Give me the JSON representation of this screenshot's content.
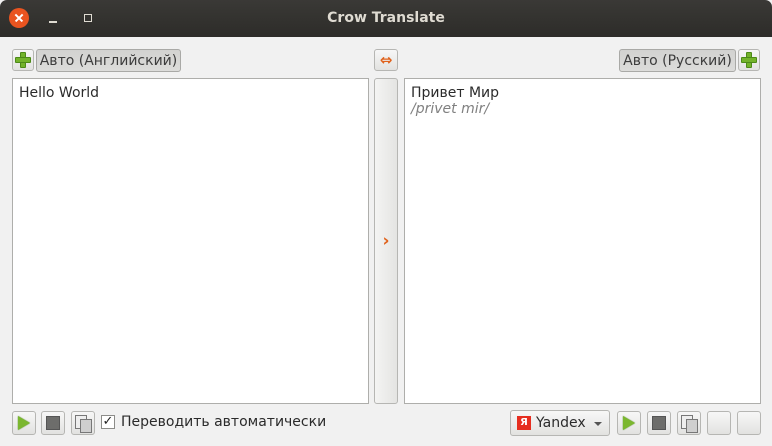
{
  "window": {
    "title": "Crow Translate"
  },
  "source": {
    "language_button": "Авто (Английский)",
    "text": "Hello World"
  },
  "translation": {
    "language_button": "Авто (Русский)",
    "text": "Привет Мир",
    "transliteration": "/privet mir/"
  },
  "options": {
    "auto_translate_label": "Переводить автоматически",
    "auto_translate_checked": true,
    "check_mark": "✓"
  },
  "engine": {
    "selected": "Yandex",
    "logo_letter": "Я"
  },
  "icons": {
    "swap": "⇔",
    "translate_arrow": "›"
  }
}
